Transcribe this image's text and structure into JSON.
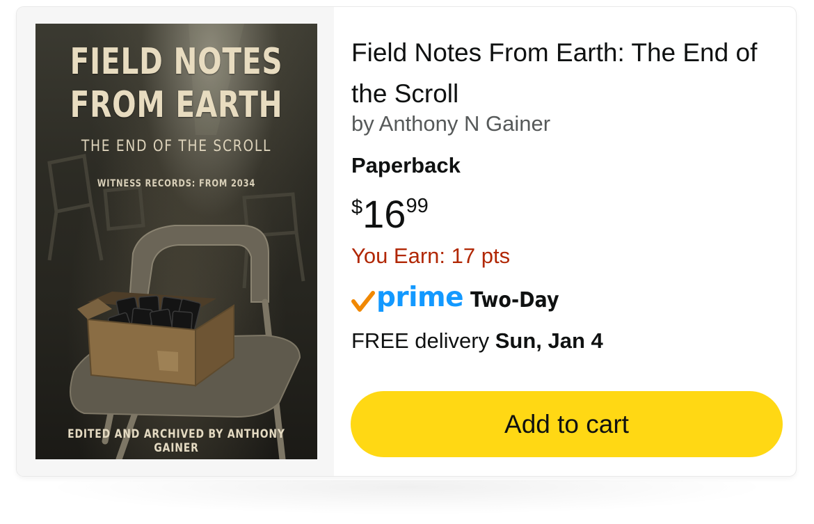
{
  "product": {
    "cover": {
      "title_line1": "FIELD NOTES",
      "title_line2": "FROM EARTH",
      "subtitle": "THE END OF THE SCROLL",
      "witness": "WITNESS RECORDS: FROM 2034",
      "editor": "EDITED AND ARCHIVED BY ANTHONY GAINER"
    },
    "title": "Field Notes From Earth: The End of the Scroll",
    "author": "by Anthony N Gainer",
    "format": "Paperback",
    "price": {
      "symbol": "$",
      "whole": "16",
      "fraction": "99"
    },
    "points": "You Earn: 17 pts",
    "prime": {
      "logo_text": "prime",
      "speed": "Two-Day",
      "check_color": "#f08804",
      "logo_color": "#1399ff"
    },
    "delivery": {
      "label": "FREE delivery ",
      "date": "Sun, Jan 4"
    },
    "add_to_cart_label": "Add to cart"
  },
  "colors": {
    "button": "#ffd814",
    "points": "#b12704",
    "author": "#565959"
  }
}
